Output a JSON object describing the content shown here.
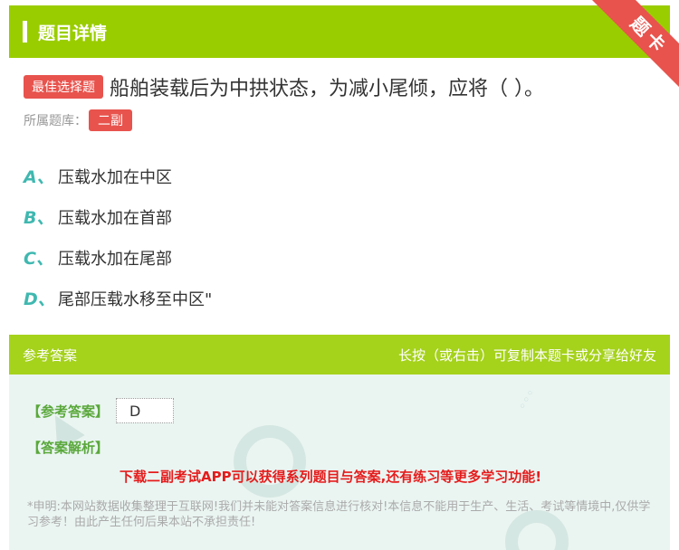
{
  "header": {
    "title": "题目详情"
  },
  "ribbon": {
    "label": "题卡"
  },
  "question": {
    "tag": "最佳选择题",
    "text": "船舶装载后为中拱状态，为减小尾倾，应将（   ）。",
    "bank_label": "所属题库：",
    "bank_value": "二副"
  },
  "options": [
    {
      "letter": "A、",
      "text": "压载水加在中区"
    },
    {
      "letter": "B、",
      "text": "压载水加在首部"
    },
    {
      "letter": "C、",
      "text": "压载水加在尾部"
    },
    {
      "letter": "D、",
      "text": "尾部压载水移至中区\""
    }
  ],
  "answer": {
    "section_title": "参考答案",
    "hint": "长按（或右击）可复制本题卡或分享给好友",
    "ref_label": "【参考答案】",
    "ref_value": "D",
    "analysis_label": "【答案解析】",
    "promo": "下载二副考试APP可以获得系列题目与答案,还有练习等更多学习功能!",
    "notice": "*申明:本网站数据收集整理于互联网!我们并未能对答案信息进行核对!本信息不能用于生产、生活、考试等情境中,仅供学习参考！由此产生任何后果本站不承担责任!"
  },
  "colors": {
    "header_green": "#9acd00",
    "accent_red": "#e8534d",
    "option_letter": "#3fb8b0",
    "answer_green": "#5aa83b",
    "promo_red": "#e51c1c"
  }
}
